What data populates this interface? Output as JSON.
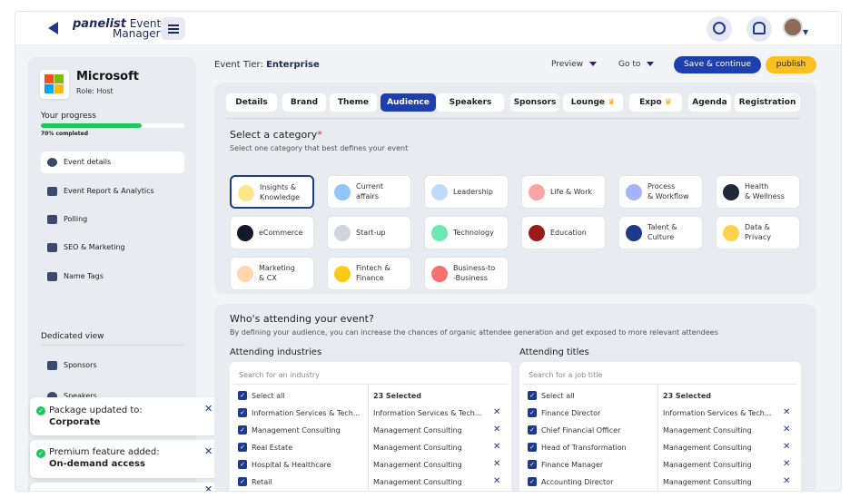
{
  "header": {
    "logo_brand": "panelist",
    "logo_line1": "Event",
    "logo_line2": "Manager"
  },
  "sidebar": {
    "company": "Microsoft",
    "role": "Role: Host",
    "progress_label": "Your progress",
    "progress_value": 0.7,
    "progress_text": "70% completed",
    "items": [
      {
        "label": "Event details",
        "icon": "info-icon",
        "active": true
      },
      {
        "label": "Event Report & Analytics",
        "icon": "users-icon",
        "active": false
      },
      {
        "label": "Polling",
        "icon": "polling-icon",
        "active": false
      },
      {
        "label": "SEO & Marketing",
        "icon": "seo-icon",
        "active": false
      },
      {
        "label": "Name Tags",
        "icon": "nametag-icon",
        "active": false
      }
    ],
    "dedicated_view": "Dedicated view",
    "dedicated_items": [
      {
        "label": "Sponsors",
        "icon": "sponsors-icon"
      },
      {
        "label": "Speakers",
        "icon": "speakers-icon"
      }
    ]
  },
  "toasts": [
    {
      "line1": "Package updated to:",
      "line2": "Corporate"
    },
    {
      "line1": "Premium feature added:",
      "line2": "On-demand access"
    }
  ],
  "topbar": {
    "tier_label": "Event Tier:",
    "tier_value": "Enterprise",
    "preview": "Preview",
    "goto": "Go to",
    "save": "Save & continue",
    "publish": "publish"
  },
  "tabs": [
    {
      "label": "Details",
      "active": false,
      "premium": false
    },
    {
      "label": "Brand",
      "active": false,
      "premium": false
    },
    {
      "label": "Theme",
      "active": false,
      "premium": false
    },
    {
      "label": "Audience",
      "active": true,
      "premium": false
    },
    {
      "label": "Speakers",
      "active": false,
      "premium": false
    },
    {
      "label": "Sponsors",
      "active": false,
      "premium": false
    },
    {
      "label": "Lounge",
      "active": false,
      "premium": true
    },
    {
      "label": "Expo",
      "active": false,
      "premium": true
    },
    {
      "label": "Agenda",
      "active": false,
      "premium": false
    },
    {
      "label": "Registration",
      "active": false,
      "premium": false
    }
  ],
  "category": {
    "title": "Select a category",
    "required_mark": "*",
    "subtitle": "Select one category that best defines your event",
    "items": [
      {
        "line1": "Insights &",
        "line2": "Knowledge",
        "selected": true,
        "color": "#fde68a"
      },
      {
        "line1": "Current",
        "line2": "affairs",
        "selected": false,
        "color": "#93c5fd"
      },
      {
        "line1": "Leadership",
        "line2": "",
        "selected": false,
        "color": "#bfdbfe"
      },
      {
        "line1": "Life & Work",
        "line2": "",
        "selected": false,
        "color": "#fca5a5"
      },
      {
        "line1": "Process",
        "line2": "& Workflow",
        "selected": false,
        "color": "#a5b4fc"
      },
      {
        "line1": "Health",
        "line2": "& Wellness",
        "selected": false,
        "color": "#1f2937"
      },
      {
        "line1": "eCommerce",
        "line2": "",
        "selected": false,
        "color": "#111827"
      },
      {
        "line1": "Start-up",
        "line2": "",
        "selected": false,
        "color": "#d1d5db"
      },
      {
        "line1": "Technology",
        "line2": "",
        "selected": false,
        "color": "#6ee7b7"
      },
      {
        "line1": "Education",
        "line2": "",
        "selected": false,
        "color": "#991b1b"
      },
      {
        "line1": "Talent &",
        "line2": "Culture",
        "selected": false,
        "color": "#1e3a8a"
      },
      {
        "line1": "Data &",
        "line2": "Privacy",
        "selected": false,
        "color": "#fcd34d"
      },
      {
        "line1": "Marketing",
        "line2": "& CX",
        "selected": false,
        "color": "#fed7aa"
      },
      {
        "line1": "Fintech &",
        "line2": "Finance",
        "selected": false,
        "color": "#facc15"
      },
      {
        "line1": "Business-to",
        "line2": "-Business",
        "selected": false,
        "color": "#f87171"
      }
    ]
  },
  "audience": {
    "title": "Who's attending your event?",
    "subtitle": "By defining your audience, you can increase the chances of organic attendee generation and get exposed to more relevant attendees",
    "industries": {
      "heading": "Attending industries",
      "placeholder": "Search for an industry",
      "select_all": "Select all",
      "selected_count": "23 Selected",
      "left": [
        "Information Services & Tech...",
        "Management Consulting",
        "Real Estate",
        "Hospital & Healthcare",
        "Retail"
      ],
      "right": [
        "Information Services & Tech...",
        "Management Consulting",
        "Management Consulting",
        "Management Consulting",
        "Management Consulting"
      ]
    },
    "titles": {
      "heading": "Attending titles",
      "placeholder": "Search for a job title",
      "select_all": "Select all",
      "selected_count": "23 Selected",
      "left": [
        "Finance Director",
        "Chief Financial Officer",
        "Head of Transformation",
        "Finance Manager",
        "Accounting Director"
      ],
      "right": [
        "Information Services & Tech...",
        "Management Consulting",
        "Management Consulting",
        "Management Consulting",
        "Management Consulting"
      ]
    }
  }
}
